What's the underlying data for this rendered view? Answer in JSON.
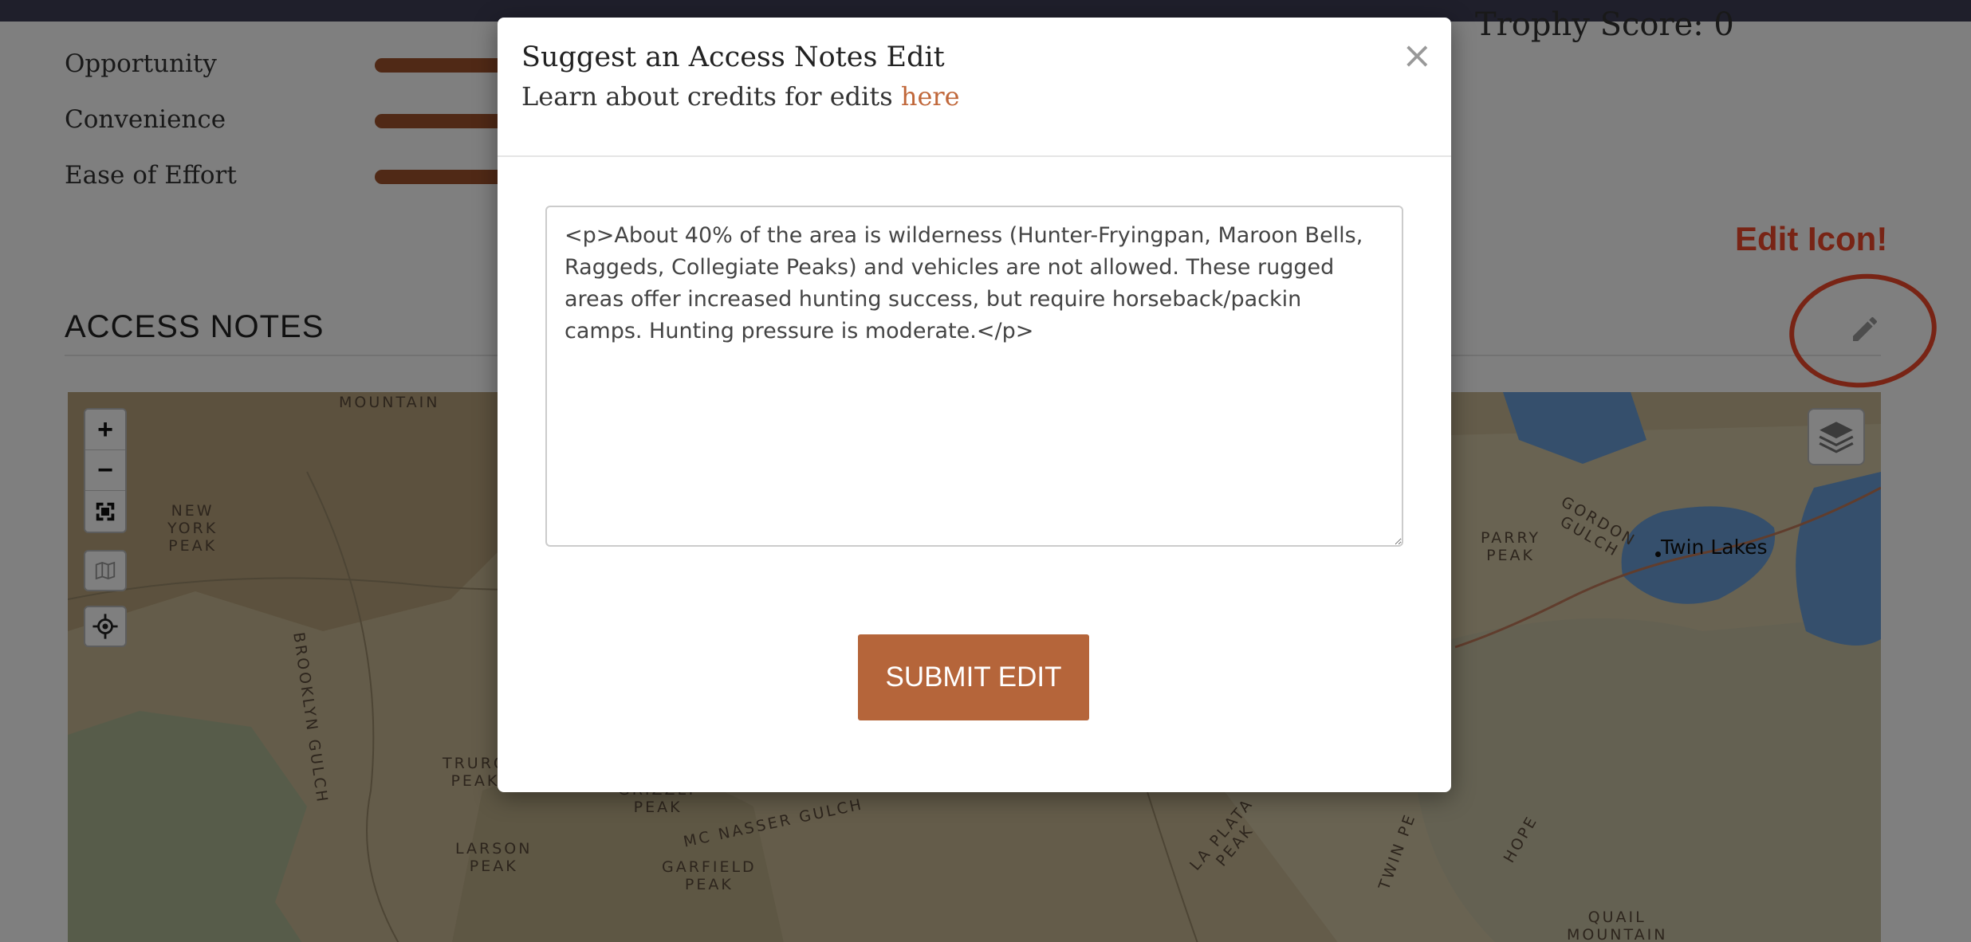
{
  "ratings": [
    {
      "label": "Opportunity"
    },
    {
      "label": "Convenience"
    },
    {
      "label": "Ease of Effort"
    }
  ],
  "trophy_score": "Trophy Score: 0",
  "access_notes": {
    "title": "ACCESS NOTES",
    "edit_icon": "pencil-icon"
  },
  "annotation": {
    "label": "Edit Icon!",
    "color": "#f0482a"
  },
  "map": {
    "zoom_in": "+",
    "zoom_out": "−",
    "labels": {
      "mountain_top": "MOUNTAIN",
      "new_york_peak": "NEW\nYORK\nPEAK",
      "brooklyn_gulch": "BROOKLYN GULCH",
      "truro_peak": "TRURO\nPEAK",
      "larson_peak": "LARSON\nPEAK",
      "garfield_peak": "GARFIELD\nPEAK",
      "grizzly_peak": "GRIZZLY\nPEAK",
      "mc_nasser_gulch": "MC NASSER GULCH",
      "parry_peak": "PARRY\nPEAK",
      "gordon_gulch": "GORDON\nGULCH",
      "twin_lakes": "Twin Lakes",
      "la_plata_peak": "LA PLATA\nPEAK",
      "twin_peaks": "TWIN PE",
      "hope": "HOPE",
      "quail_mountain": "QUAIL\nMOUNTAIN"
    }
  },
  "modal": {
    "title": "Suggest an Access Notes Edit",
    "subtitle_prefix": "Learn about credits for edits ",
    "subtitle_link": "here",
    "close_label": "×",
    "notes_value": "<p>About 40% of the area is wilderness (Hunter-Fryingpan, Maroon Bells, Raggeds, Collegiate Peaks) and vehicles are not allowed. These rugged areas offer increased hunting success, but require horseback/packin camps. Hunting pressure is moderate.</p>",
    "submit_label": "SUBMIT EDIT"
  },
  "colors": {
    "accent": "#b5653a",
    "rating_bar": "#a0522d",
    "topbar": "#3f3e56"
  }
}
